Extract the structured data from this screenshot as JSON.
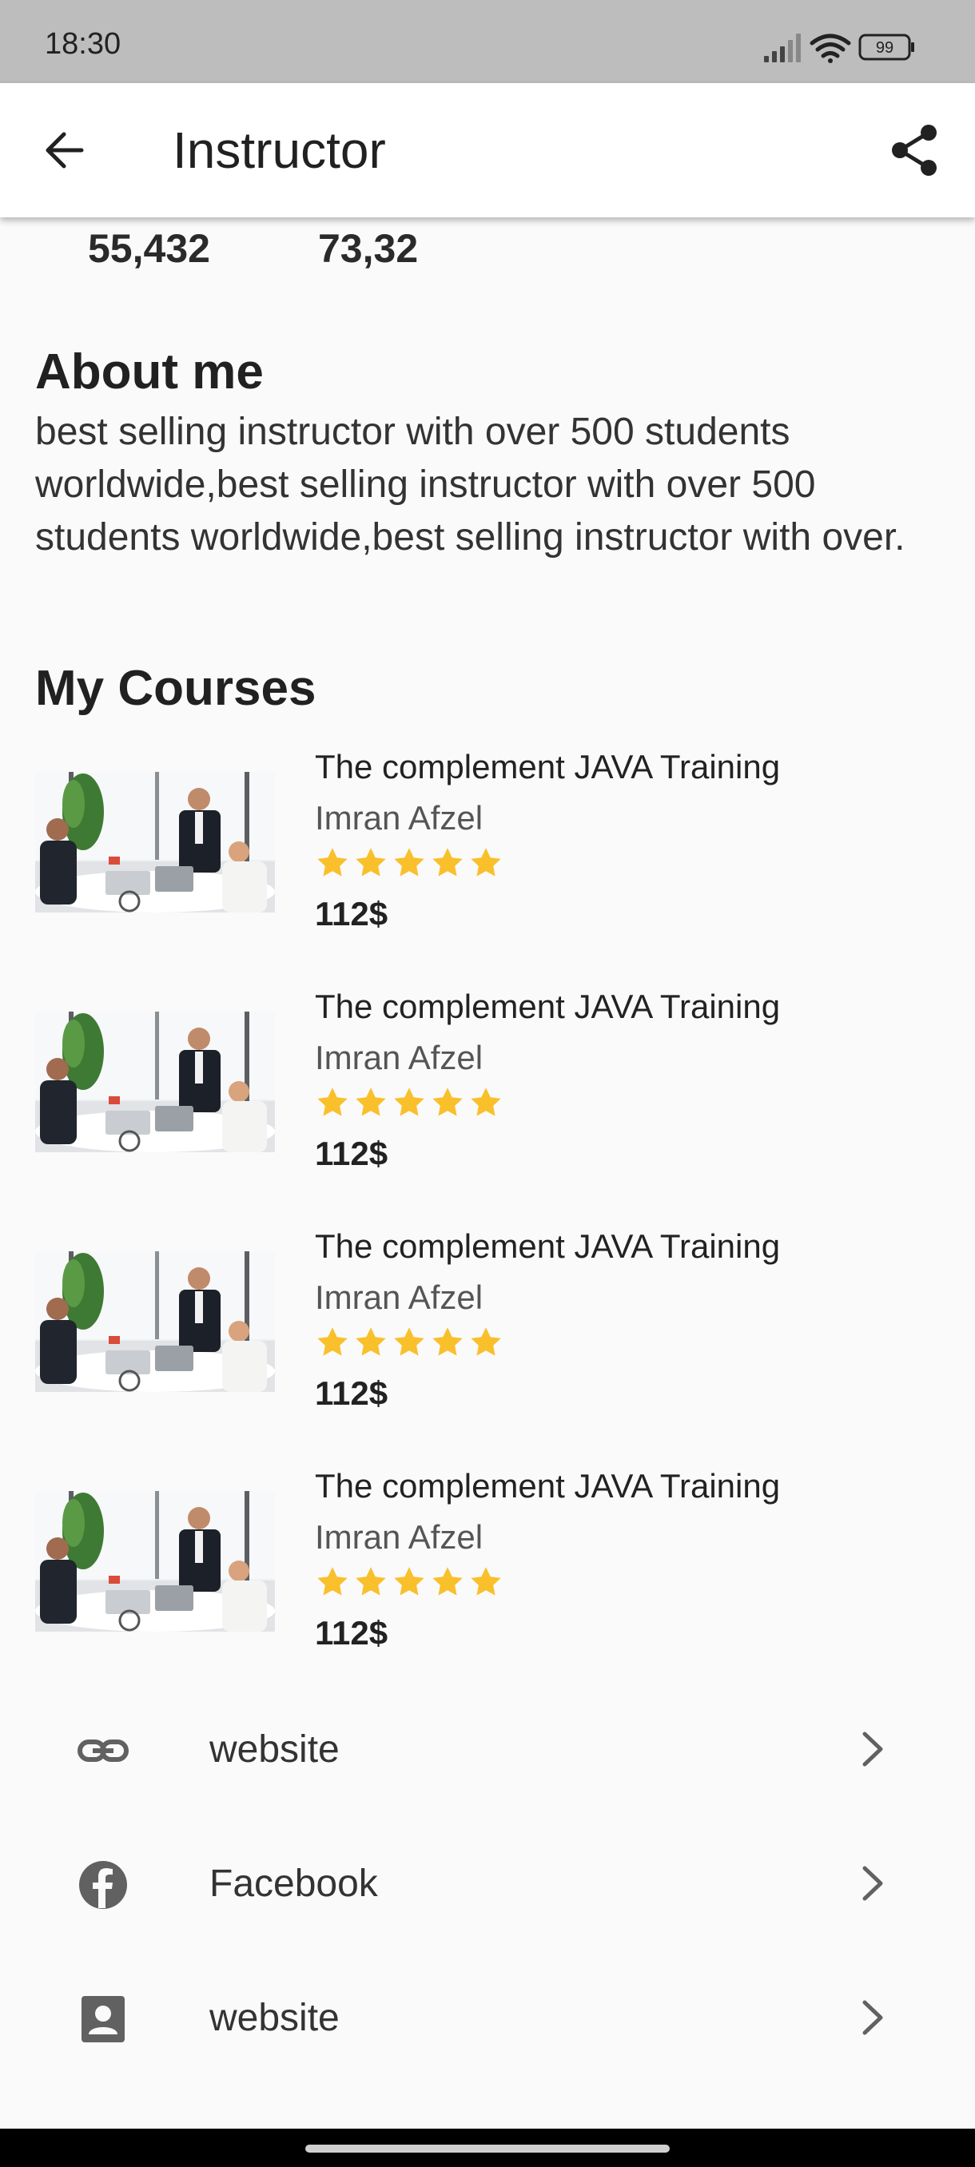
{
  "status_bar": {
    "time": "18:30",
    "battery": "99"
  },
  "app_bar": {
    "title": "Instructor"
  },
  "stats": {
    "left_value": "55,432",
    "right_value": "73,32"
  },
  "about": {
    "heading": "About me",
    "text": "best selling instructor with over 500 students worldwide,best selling instructor with over 500 students worldwide,best selling instructor with over."
  },
  "courses": {
    "heading": "My Courses",
    "items": [
      {
        "title": "The complement JAVA Training",
        "author": "Imran Afzel",
        "rating": 5,
        "price": "112$"
      },
      {
        "title": "The complement JAVA Training",
        "author": "Imran Afzel",
        "rating": 5,
        "price": "112$"
      },
      {
        "title": "The complement JAVA Training",
        "author": "Imran Afzel",
        "rating": 5,
        "price": "112$"
      },
      {
        "title": "The complement JAVA Training",
        "author": "Imran Afzel",
        "rating": 5,
        "price": "112$"
      }
    ]
  },
  "links": [
    {
      "icon": "link-icon",
      "label": "website"
    },
    {
      "icon": "facebook-icon",
      "label": "Facebook"
    },
    {
      "icon": "contact-card-icon",
      "label": "website"
    }
  ],
  "colors": {
    "star": "#F9C02C",
    "status_bar": "#BDBDBD",
    "background": "#FAFAFA"
  }
}
